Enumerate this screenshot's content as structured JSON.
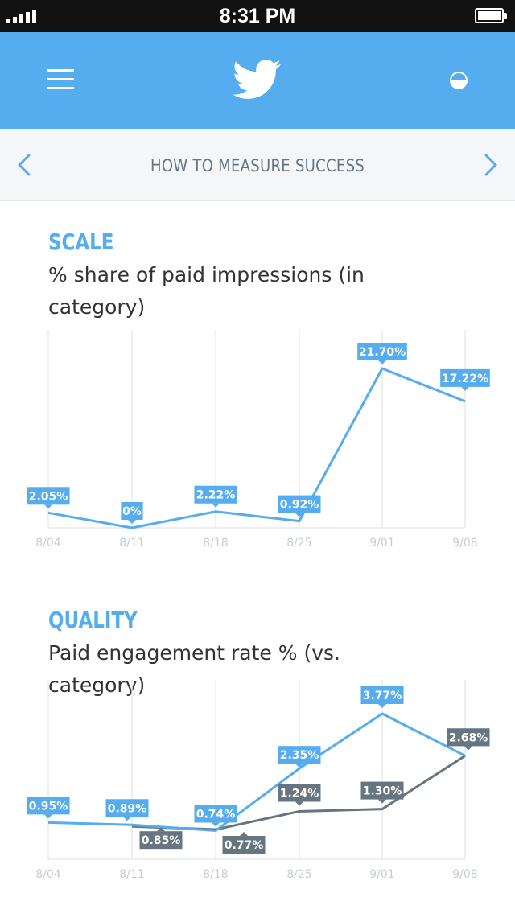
{
  "status_bar": {
    "time": "8:31 PM"
  },
  "header": {
    "menu_icon": "hamburger-menu-icon",
    "logo_icon": "twitter-bird-icon",
    "right_icon": "half-circle-toggle-icon"
  },
  "nav": {
    "title": "HOW TO MEASURE SUCCESS",
    "prev_icon": "chevron-left-icon",
    "next_icon": "chevron-right-icon"
  },
  "colors": {
    "brand_blue": "#55acee",
    "category_gray": "#66757f",
    "grid": "#e8eaed",
    "axis_label": "#c8cdd2"
  },
  "scale": {
    "title": "SCALE",
    "subtitle": "% share of paid impressions (in category)"
  },
  "quality": {
    "title": "QUALITY",
    "subtitle": "Paid engagement rate % (vs. category)"
  },
  "chart_data": [
    {
      "type": "line",
      "title": "SCALE",
      "subtitle": "% share of paid impressions (in category)",
      "categories": [
        "8/04",
        "8/11",
        "8/18",
        "8/25",
        "9/01",
        "9/08"
      ],
      "series": [
        {
          "values": [
            2.05,
            0,
            2.22,
            0.92,
            21.7,
            17.22
          ],
          "labels": [
            "2.05%",
            "0%",
            "2.22%",
            "0.92%",
            "21.70%",
            "17.22%"
          ],
          "color": "#55acee"
        }
      ],
      "ylim": [
        0,
        21.7
      ],
      "grid": true,
      "xlabel": "",
      "ylabel": ""
    },
    {
      "type": "line",
      "title": "QUALITY",
      "subtitle": "Paid engagement rate % (vs. category)",
      "categories": [
        "8/04",
        "8/11",
        "8/18",
        "8/25",
        "9/01",
        "9/08"
      ],
      "series": [
        {
          "values": [
            0.95,
            0.89,
            0.74,
            2.35,
            3.77,
            2.68
          ],
          "labels": [
            "0.95%",
            "0.89%",
            "0.74%",
            "2.35%",
            "3.77%",
            "2.68%"
          ],
          "color": "#55acee"
        },
        {
          "values": [
            null,
            0.85,
            0.77,
            1.24,
            1.3,
            2.68
          ],
          "labels": [
            null,
            "0.85%",
            "0.77%",
            "1.24%",
            "1.30%",
            "2.68%"
          ],
          "color": "#66757f"
        }
      ],
      "ylim": [
        0,
        3.77
      ],
      "grid": true,
      "xlabel": "",
      "ylabel": ""
    }
  ]
}
